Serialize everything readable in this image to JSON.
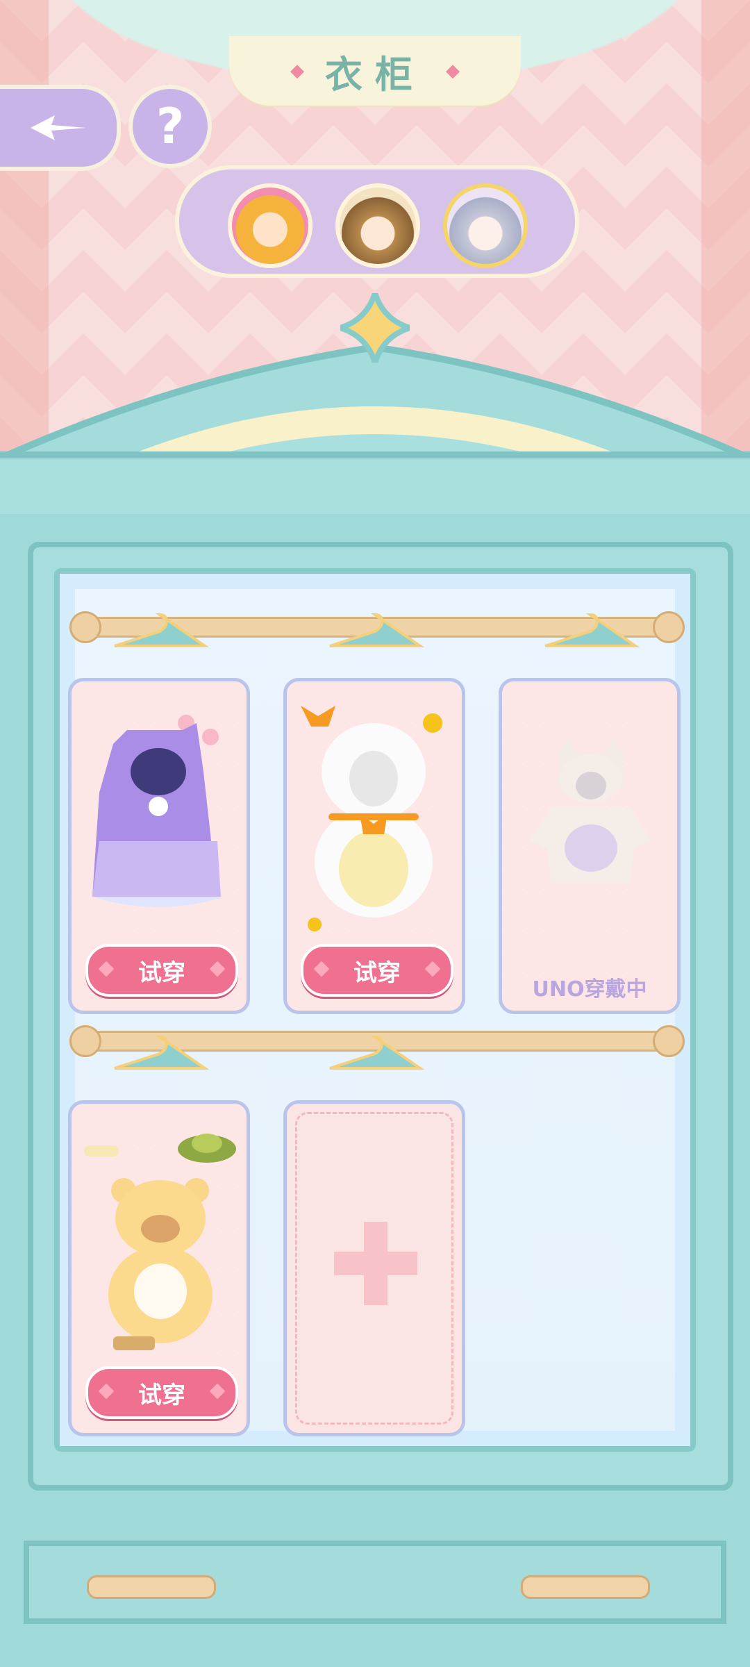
{
  "header": {
    "title": "衣柜"
  },
  "controls": {
    "help_label": "?"
  },
  "characters": [
    {
      "name": "character-1"
    },
    {
      "name": "character-2"
    },
    {
      "name": "character-3",
      "selected": true
    }
  ],
  "outfits": [
    {
      "button_label": "试穿"
    },
    {
      "button_label": "试穿"
    },
    {
      "status_label": "UNO穿戴中"
    },
    {
      "button_label": "试穿"
    }
  ],
  "colors": {
    "accent": "#f07090",
    "frame": "#9fd9d8",
    "panel": "#c9b4ea"
  }
}
